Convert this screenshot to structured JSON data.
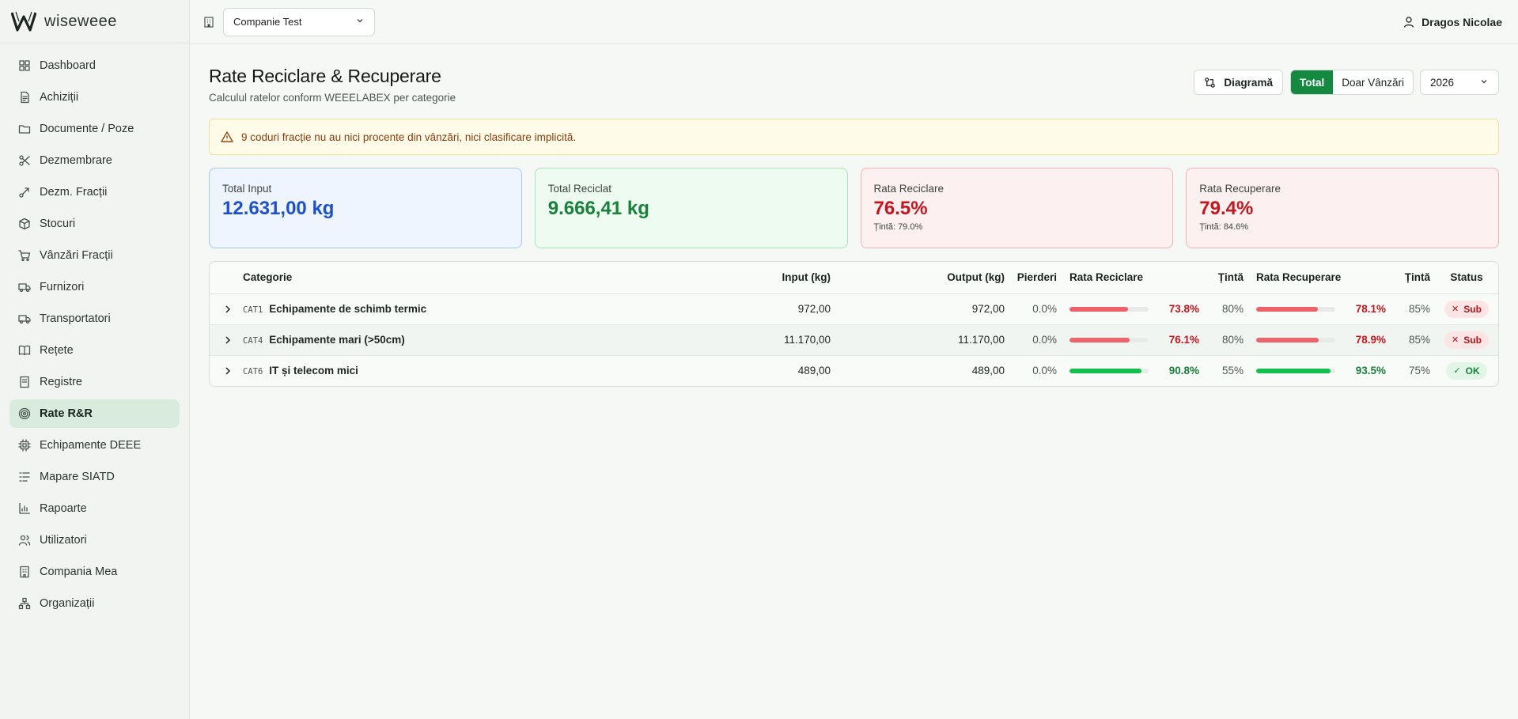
{
  "brand": {
    "name": "wiseweee"
  },
  "sidebar": {
    "items": [
      {
        "label": "Dashboard",
        "icon": "grid-icon"
      },
      {
        "label": "Achiziții",
        "icon": "document-icon"
      },
      {
        "label": "Documente / Poze",
        "icon": "folder-icon"
      },
      {
        "label": "Dezmembrare",
        "icon": "scissors-icon"
      },
      {
        "label": "Dezm. Fracții",
        "icon": "split-icon"
      },
      {
        "label": "Stocuri",
        "icon": "box-icon"
      },
      {
        "label": "Vânzări Fracții",
        "icon": "cart-icon"
      },
      {
        "label": "Furnizori",
        "icon": "truck-icon"
      },
      {
        "label": "Transportatori",
        "icon": "truck-icon"
      },
      {
        "label": "Rețete",
        "icon": "book-icon"
      },
      {
        "label": "Registre",
        "icon": "register-icon"
      },
      {
        "label": "Rate R&R",
        "icon": "target-icon",
        "active": true
      },
      {
        "label": "Echipamente DEEE",
        "icon": "chip-icon"
      },
      {
        "label": "Mapare SIATD",
        "icon": "list-icon"
      },
      {
        "label": "Rapoarte",
        "icon": "chart-icon"
      },
      {
        "label": "Utilizatori",
        "icon": "users-icon"
      },
      {
        "label": "Compania Mea",
        "icon": "building-icon"
      },
      {
        "label": "Organizații",
        "icon": "network-icon"
      }
    ]
  },
  "topbar": {
    "company": "Companie Test",
    "user": "Dragos Nicolae"
  },
  "page": {
    "title": "Rate Reciclare & Recuperare",
    "subtitle": "Calculul ratelor conform WEEELABEX per categorie"
  },
  "controls": {
    "diagram": "Diagramă",
    "total": "Total",
    "sales_only": "Doar Vânzări",
    "year": "2026"
  },
  "alert": {
    "text": "9 coduri fracție nu au nici procente din vânzări, nici clasificare implicită."
  },
  "cards": {
    "total_input": {
      "label": "Total Input",
      "value": "12.631,00 kg"
    },
    "total_recycled": {
      "label": "Total Reciclat",
      "value": "9.666,41 kg"
    },
    "recycling_rate": {
      "label": "Rata Reciclare",
      "value": "76.5%",
      "target": "Țintă: 79.0%"
    },
    "recovery_rate": {
      "label": "Rata Recuperare",
      "value": "79.4%",
      "target": "Țintă: 84.6%"
    }
  },
  "table": {
    "headers": {
      "category": "Categorie",
      "input": "Input (kg)",
      "output": "Output (kg)",
      "losses": "Pierderi",
      "recycling_rate": "Rata Reciclare",
      "target1": "Țintă",
      "recovery_rate": "Rata Recuperare",
      "target2": "Țintă",
      "status": "Status"
    },
    "rows": [
      {
        "code": "CAT1",
        "name": "Echipamente de schimb termic",
        "input": "972,00",
        "output": "972,00",
        "losses": "0.0%",
        "rec_pct": "73.8%",
        "rec_val": 73.8,
        "rec_target": "80%",
        "recov_pct": "78.1%",
        "recov_val": 78.1,
        "recov_target": "85%",
        "status": "Sub",
        "ok": false
      },
      {
        "code": "CAT4",
        "name": "Echipamente mari (>50cm)",
        "input": "11.170,00",
        "output": "11.170,00",
        "losses": "0.0%",
        "rec_pct": "76.1%",
        "rec_val": 76.1,
        "rec_target": "80%",
        "recov_pct": "78.9%",
        "recov_val": 78.9,
        "recov_target": "85%",
        "status": "Sub",
        "ok": false
      },
      {
        "code": "CAT6",
        "name": "IT și telecom mici",
        "input": "489,00",
        "output": "489,00",
        "losses": "0.0%",
        "rec_pct": "90.8%",
        "rec_val": 90.8,
        "rec_target": "55%",
        "recov_pct": "93.5%",
        "recov_val": 93.5,
        "recov_target": "75%",
        "status": "OK",
        "ok": true
      }
    ]
  },
  "colors": {
    "accent": "#138a3f",
    "bar_red": "#f0616a",
    "bar_green": "#13c04f"
  }
}
